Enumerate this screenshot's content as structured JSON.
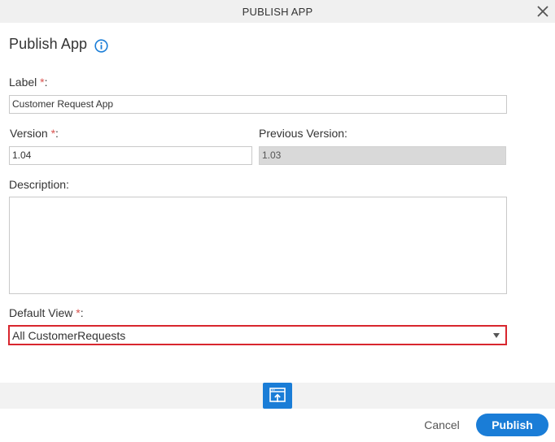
{
  "dialog": {
    "title": "PUBLISH APP",
    "heading": "Publish App",
    "close_icon": "close-icon",
    "info_icon": "info-icon"
  },
  "form": {
    "label": {
      "text": "Label",
      "required_mark": "*",
      "colon": ":",
      "value": "Customer Request App"
    },
    "version": {
      "text": "Version",
      "required_mark": "*",
      "colon": ":",
      "value": "1.04"
    },
    "previous_version": {
      "text": "Previous Version:",
      "value": "1.03"
    },
    "description": {
      "text": "Description:",
      "value": ""
    },
    "default_view": {
      "text": "Default View",
      "required_mark": "*",
      "colon": ":",
      "selected": "All CustomerRequests"
    }
  },
  "footer": {
    "publish_icon": "publish-upload-icon",
    "cancel_label": "Cancel",
    "publish_label": "Publish"
  },
  "colors": {
    "accent": "#1a7dd7",
    "required": "#d9534f",
    "highlight_border": "#d8262e"
  }
}
